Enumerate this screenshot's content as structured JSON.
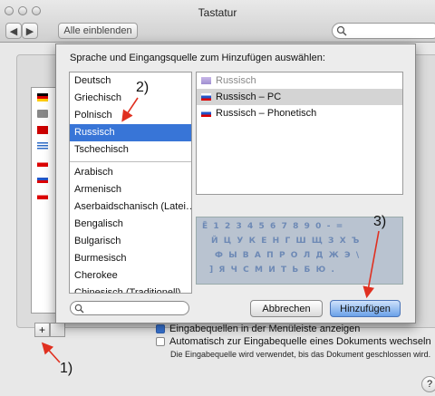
{
  "window": {
    "title": "Tastatur",
    "show_all_label": "Alle einblenden"
  },
  "sheet": {
    "prompt": "Sprache und Eingangsquelle zum Hinzufügen auswählen:",
    "languages_a": [
      "Deutsch",
      "Griechisch",
      "Polnisch",
      "Russisch",
      "Tschechisch"
    ],
    "languages_b": [
      "Arabisch",
      "Armenisch",
      "Aserbaidschanisch (Latei…",
      "Bengalisch",
      "Bulgarisch",
      "Burmesisch",
      "Cherokee",
      "Chinesisch (Traditionell)"
    ],
    "selected_language": "Russisch",
    "sources": [
      "Russisch",
      "Russisch – PC",
      "Russisch – Phonetisch"
    ],
    "keyboard_rows": [
      "Ё  1  2  3  4  5  6  7  8  9  0  -  =",
      "Й  Ц  У  К  Е  Н  Г  Ш  Щ  З  Х  Ъ",
      "Ф  Ы  В  А  П  Р  О  Л  Д  Ж  Э  \\",
      "]  Я  Ч  С  М  И  Т  Ь  Б  Ю  ."
    ],
    "cancel_label": "Abbrechen",
    "add_label": "Hinzufügen"
  },
  "background": {
    "plus_label": "+",
    "option_partial": "Eingabequellen in der Menüleiste anzeigen",
    "option_auto": "Automatisch zur Eingabequelle eines Dokuments wechseln",
    "note": "Die Eingabequelle wird verwendet, bis das Dokument geschlossen wird.",
    "help_label": "?"
  },
  "annotations": {
    "a1": "1)",
    "a2": "2)",
    "a3": "3)"
  },
  "colors": {
    "selection": "#3875d7",
    "annotation_arrow": "#e03020"
  }
}
